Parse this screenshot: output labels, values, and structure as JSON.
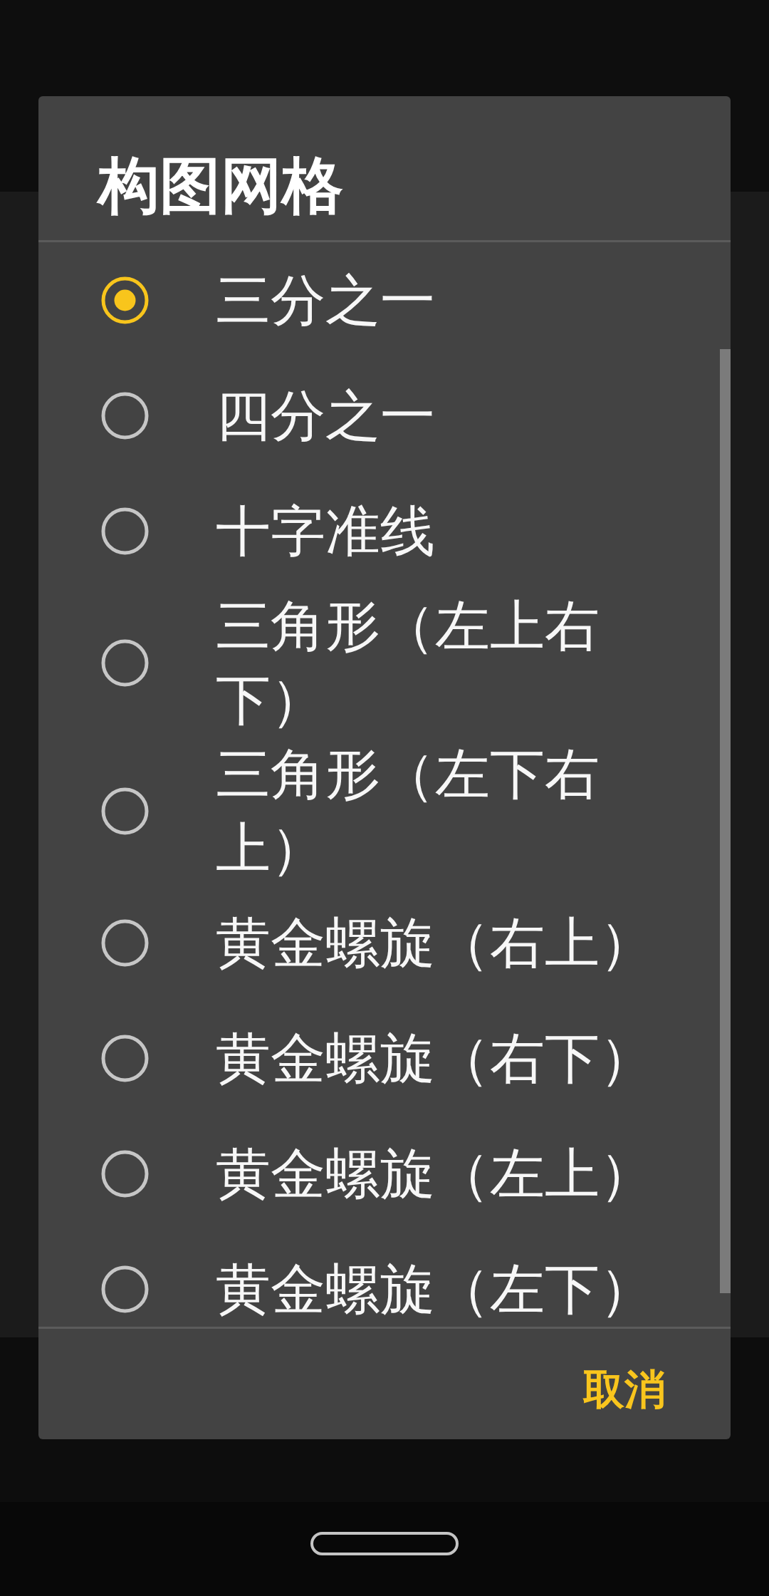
{
  "dialog": {
    "title": "构图网格",
    "options": [
      {
        "label": "三分之一",
        "selected": true
      },
      {
        "label": "四分之一",
        "selected": false
      },
      {
        "label": "十字准线",
        "selected": false
      },
      {
        "label": "三角形（左上右下）",
        "selected": false
      },
      {
        "label": "三角形（左下右上）",
        "selected": false
      },
      {
        "label": "黄金螺旋（右上）",
        "selected": false
      },
      {
        "label": "黄金螺旋（右下）",
        "selected": false
      },
      {
        "label": "黄金螺旋（左上）",
        "selected": false
      },
      {
        "label": "黄金螺旋（左下）",
        "selected": false
      }
    ],
    "buttons": [
      {
        "label": "取消"
      }
    ]
  }
}
